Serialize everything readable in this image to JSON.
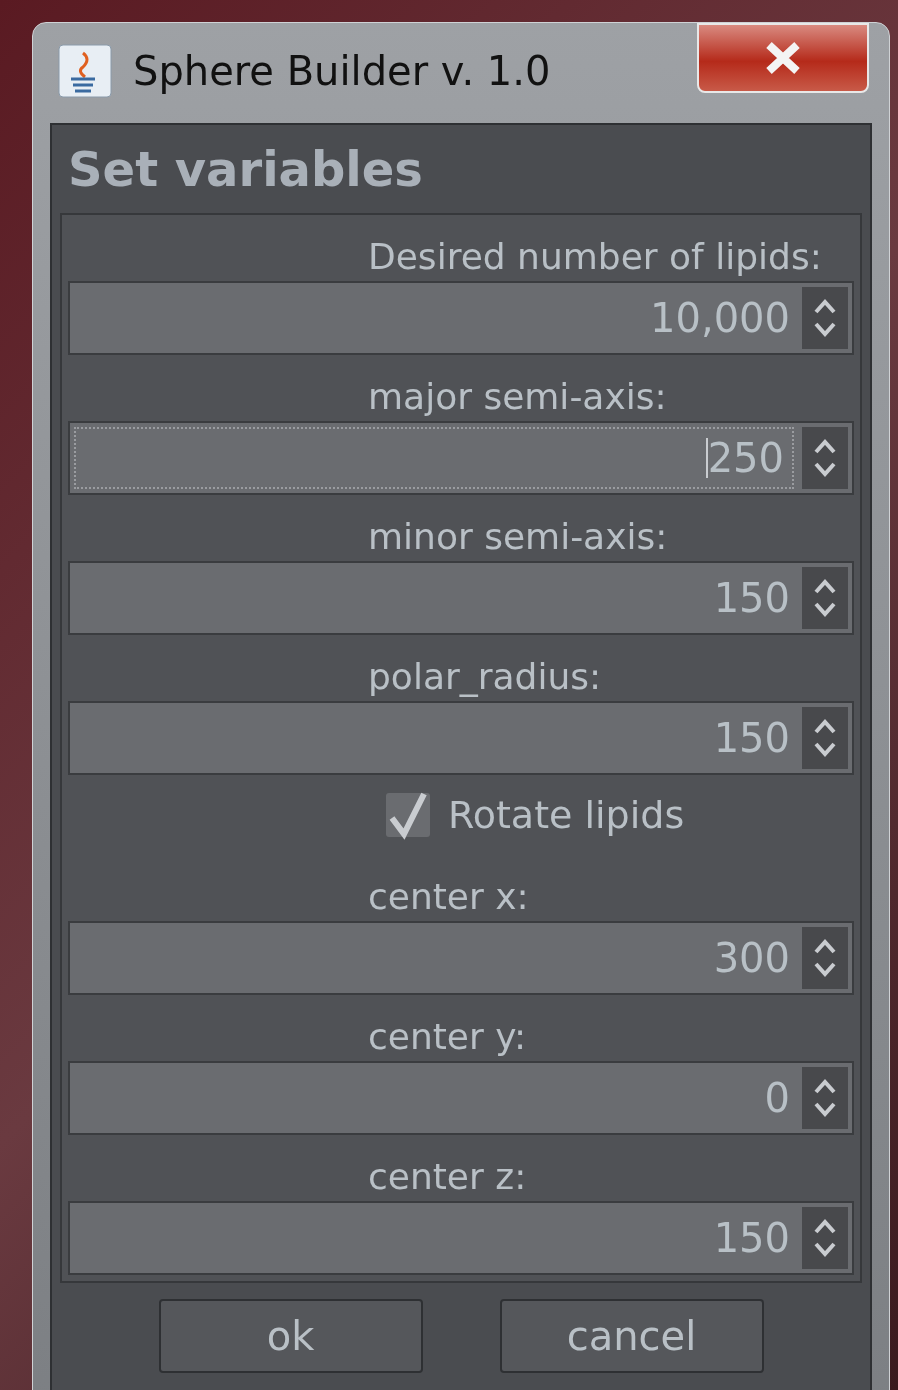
{
  "window": {
    "title": "Sphere Builder v. 1.0"
  },
  "heading": "Set variables",
  "rows": [
    {
      "kind": "spinner",
      "label": "Desired number of lipids:",
      "value": "10,000",
      "focused": false
    },
    {
      "kind": "spinner",
      "label": "major semi-axis:",
      "value": "250",
      "focused": true
    },
    {
      "kind": "spinner",
      "label": "minor semi-axis:",
      "value": "150",
      "focused": false
    },
    {
      "kind": "spinner",
      "label": "polar_radius:",
      "value": "150",
      "focused": false
    },
    {
      "kind": "checkbox",
      "text": "Rotate lipids",
      "checked": true
    },
    {
      "kind": "spinner",
      "label": "center x:",
      "value": "300",
      "focused": false
    },
    {
      "kind": "spinner",
      "label": "center y:",
      "value": "0",
      "focused": false
    },
    {
      "kind": "spinner",
      "label": "center z:",
      "value": "150",
      "focused": false
    }
  ],
  "buttons": [
    "ok",
    "cancel"
  ]
}
